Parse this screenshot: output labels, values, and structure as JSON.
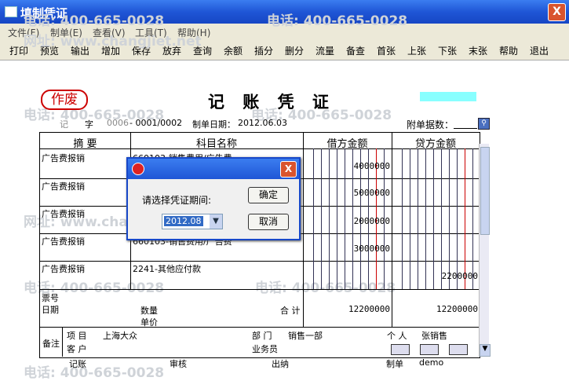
{
  "window": {
    "title": "填制凭证",
    "close_glyph": "X"
  },
  "menu": [
    "文件(F)",
    "制单(E)",
    "查看(V)",
    "工具(T)",
    "帮助(H)"
  ],
  "toolbar": [
    "打印",
    "预览",
    "输出",
    "增加",
    "保存",
    "放弃",
    "查询",
    "余额",
    "插分",
    "删分",
    "流量",
    "备查",
    "首张",
    "上张",
    "下张",
    "末张",
    "帮助",
    "退出"
  ],
  "voucher": {
    "void_stamp": "作废",
    "title": "记 账 凭 证",
    "word_label": "记",
    "zi": "字",
    "number_prefix": "0006",
    "number": "- 0001/0002",
    "date_label": "制单日期：",
    "date": "2012.06.03",
    "attach_label": "附单据数：",
    "headers": {
      "summary": "摘  要",
      "account": "科目名称",
      "debit": "借方金额",
      "credit": "贷方金额"
    },
    "rows": [
      {
        "summary": "广告费报销",
        "account": "660103-销售费用/广告费",
        "debit": "4000000",
        "credit": ""
      },
      {
        "summary": "广告费报销",
        "account": "",
        "debit": "5000000",
        "credit": ""
      },
      {
        "summary": "广告费报销",
        "account": "",
        "debit": "2000000",
        "credit": ""
      },
      {
        "summary": "广告费报销",
        "account": "660103-销售费用/广告费",
        "debit": "3000000",
        "credit": ""
      },
      {
        "summary": "广告费报销",
        "account": "2241-其他应付款",
        "debit": "",
        "credit": "2200000"
      }
    ],
    "ticket_no_label": "票号",
    "date_row_label": "日期",
    "qty_label": "数量",
    "price_label": "单价",
    "total_label": "合 计",
    "total_debit": "12200000",
    "total_credit": "12200000",
    "remark_label": "备注",
    "project_label": "项  目",
    "project_value": "上海大众",
    "customer_label": "客  户",
    "dept_label": "部  门",
    "dept_value": "销售一部",
    "person_label": "个  人",
    "person_value": "张销售",
    "salesman_label": "业务员",
    "footer": {
      "bookkeeping": "记账",
      "audit": "审核",
      "cashier": "出纳",
      "maker_label": "制单",
      "maker": "demo"
    }
  },
  "dialog": {
    "prompt": "请选择凭证期间:",
    "period": "2012.08",
    "ok": "确定",
    "cancel": "取消"
  },
  "watermarks": {
    "phone": "电话: 400-665-0028",
    "site": "网址: www.changjiet.net"
  }
}
